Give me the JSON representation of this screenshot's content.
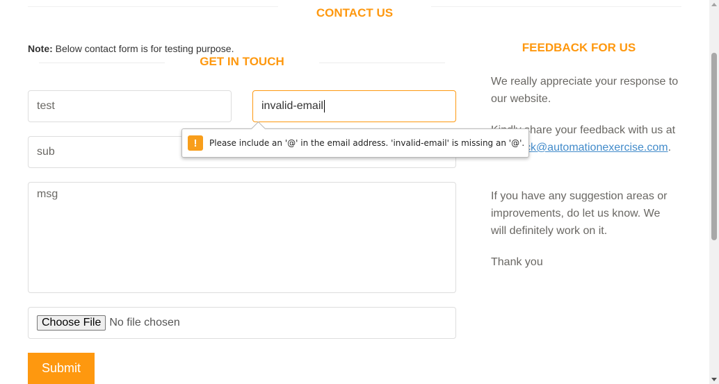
{
  "header": {
    "contact_title": "CONTACT US"
  },
  "note": {
    "label": "Note:",
    "text": " Below contact form is for testing purpose."
  },
  "form": {
    "title": "GET IN TOUCH",
    "name_value": "test",
    "email_value": "invalid-email",
    "subject_value": "sub",
    "message_value": "msg",
    "file_button": "Choose File",
    "file_status": "No file chosen",
    "submit_label": "Submit"
  },
  "validation": {
    "message": "Please include an '@' in the email address. 'invalid-email' is missing an '@'.",
    "icon": "!"
  },
  "feedback": {
    "title": "FEEDBACK FOR US",
    "p1": "We really appreciate your response to our website.",
    "p2": "Kindly share your feedback with us at",
    "email": "feedback@automationexercise.com",
    "period": ".",
    "p3": "If you have any suggestion areas or improvements, do let us know. We will definitely work on it.",
    "p4": "Thank you"
  },
  "colors": {
    "accent": "#FE980F",
    "link": "#428bca",
    "warning": "#F89E1B"
  }
}
